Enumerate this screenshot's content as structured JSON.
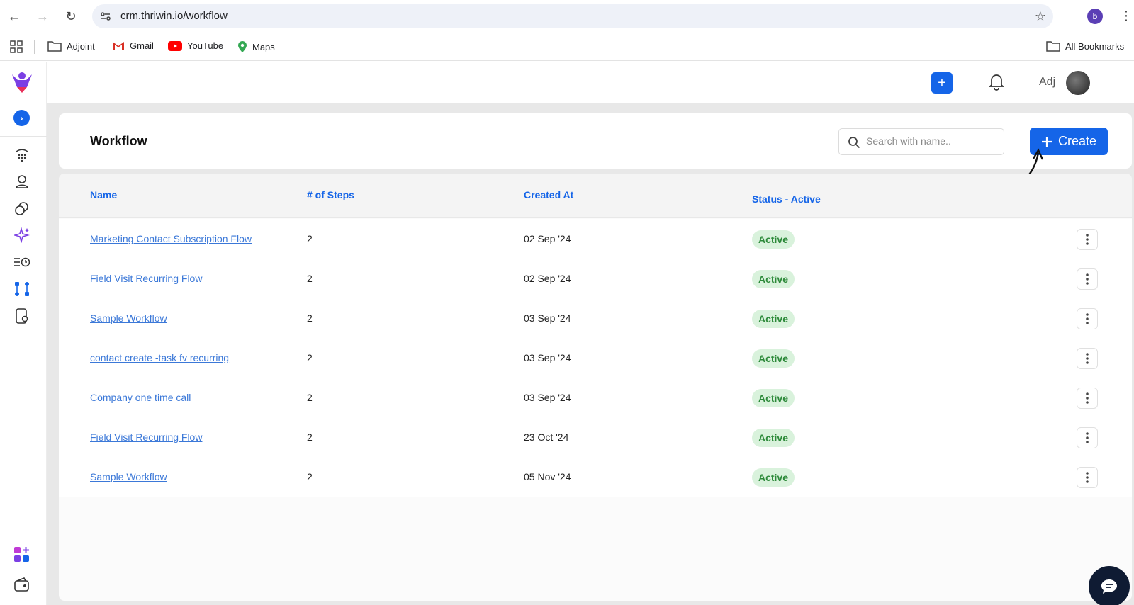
{
  "browser": {
    "url": "crm.thriwin.io/workflow",
    "profile_initial": "b",
    "bookmarks": [
      {
        "label": "Adjoint",
        "icon": "folder-icon"
      },
      {
        "label": "Gmail",
        "icon": "gmail-icon"
      },
      {
        "label": "YouTube",
        "icon": "youtube-icon"
      },
      {
        "label": "Maps",
        "icon": "maps-icon"
      }
    ],
    "all_bookmarks": "All Bookmarks"
  },
  "header": {
    "user_name": "Adj"
  },
  "page": {
    "title": "Workflow",
    "search_placeholder": "Search with name..",
    "create_label": "Create"
  },
  "table": {
    "columns": {
      "name": "Name",
      "steps": "# of Steps",
      "created": "Created At",
      "status": "Status - Active"
    },
    "rows": [
      {
        "name": "Marketing Contact Subscription Flow",
        "steps": "2",
        "created": "02 Sep '24",
        "status": "Active"
      },
      {
        "name": "Field Visit Recurring Flow",
        "steps": "2",
        "created": "02 Sep '24",
        "status": "Active"
      },
      {
        "name": "Sample Workflow",
        "steps": "2",
        "created": "03 Sep '24",
        "status": "Active"
      },
      {
        "name": "contact create -task fv recurring",
        "steps": "2",
        "created": "03 Sep '24",
        "status": "Active"
      },
      {
        "name": "Company one time call",
        "steps": "2",
        "created": "03 Sep '24",
        "status": "Active"
      },
      {
        "name": "Field Visit Recurring Flow",
        "steps": "2",
        "created": "23 Oct '24",
        "status": "Active"
      },
      {
        "name": "Sample Workflow",
        "steps": "2",
        "created": "05 Nov '24",
        "status": "Active"
      }
    ]
  },
  "colors": {
    "accent": "#1565e8",
    "active_badge_bg": "#d9f2dc",
    "active_badge_text": "#2d8a3a"
  }
}
